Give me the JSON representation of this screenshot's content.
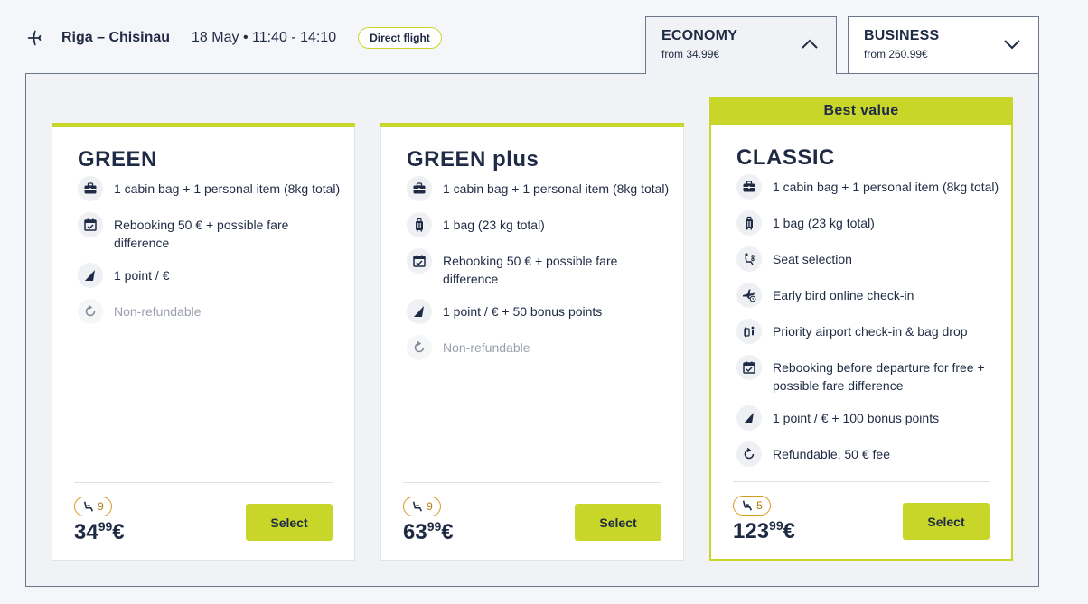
{
  "header": {
    "route": "Riga – Chisinau",
    "datetime": "18 May • 11:40 - 14:10",
    "badge": "Direct flight"
  },
  "tabs": [
    {
      "name": "ECONOMY",
      "from": "from 34.99€",
      "active": true
    },
    {
      "name": "BUSINESS",
      "from": "from 260.99€",
      "active": false
    }
  ],
  "fares": [
    {
      "name": "GREEN",
      "features": [
        {
          "icon": "briefcase-icon",
          "text": "1 cabin bag + 1 personal item (8kg total)"
        },
        {
          "icon": "calendar-check-icon",
          "text": "Rebooking 50 € + possible fare difference"
        },
        {
          "icon": "points-icon",
          "text": "1 point / €"
        },
        {
          "icon": "refund-icon",
          "text": "Non-refundable",
          "muted": true
        }
      ],
      "seats_left": "9",
      "price_main": "34",
      "price_cents": "99",
      "currency": "€",
      "select_label": "Select"
    },
    {
      "name": "GREEN plus",
      "features": [
        {
          "icon": "briefcase-icon",
          "text": "1 cabin bag + 1 personal item (8kg total)"
        },
        {
          "icon": "luggage-icon",
          "text": "1 bag (23 kg total)"
        },
        {
          "icon": "calendar-check-icon",
          "text": "Rebooking 50 € + possible fare difference"
        },
        {
          "icon": "points-icon",
          "text": "1 point / € + 50 bonus points"
        },
        {
          "icon": "refund-icon",
          "text": "Non-refundable",
          "muted": true
        }
      ],
      "seats_left": "9",
      "price_main": "63",
      "price_cents": "99",
      "currency": "€",
      "select_label": "Select"
    },
    {
      "name": "CLASSIC",
      "badge": "Best value",
      "features": [
        {
          "icon": "briefcase-icon",
          "text": "1 cabin bag + 1 personal item (8kg total)"
        },
        {
          "icon": "luggage-icon",
          "text": "1 bag (23 kg total)"
        },
        {
          "icon": "seat-icon",
          "text": "Seat selection"
        },
        {
          "icon": "plane-clock-icon",
          "text": "Early bird online check-in"
        },
        {
          "icon": "priority-checkin-icon",
          "text": "Priority airport check-in & bag drop"
        },
        {
          "icon": "calendar-check-icon",
          "text": "Rebooking before departure for free + possible fare difference"
        },
        {
          "icon": "points-icon",
          "text": "1 point / € + 100 bonus points"
        },
        {
          "icon": "refund-icon",
          "text": "Refundable, 50 € fee"
        }
      ],
      "seats_left": "5",
      "price_main": "123",
      "price_cents": "99",
      "currency": "€",
      "select_label": "Select"
    }
  ],
  "colors": {
    "accent": "#c8d62a",
    "text": "#1f2a44",
    "seat_badge": "#d69a1e"
  }
}
